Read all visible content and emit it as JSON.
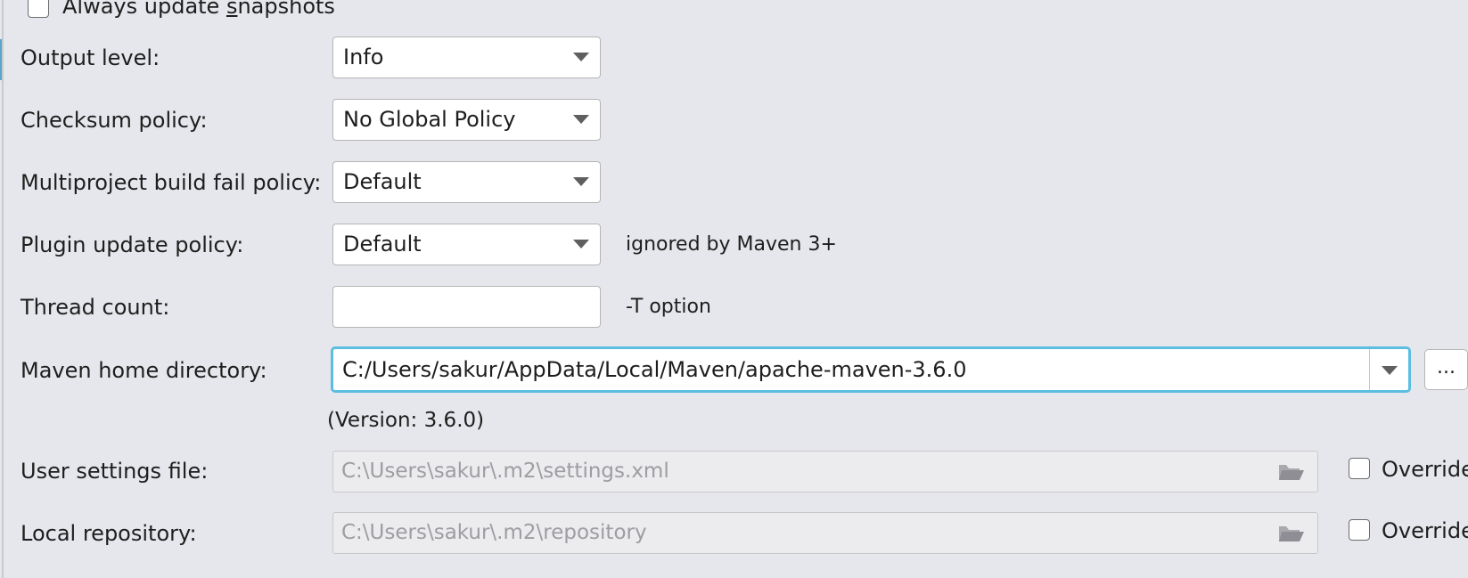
{
  "always_update": {
    "label_prefix": "Always update ",
    "label_mnemonic": "s",
    "label_suffix": "napshots",
    "checked": false
  },
  "output_level": {
    "label": "Output level:",
    "value": "Info"
  },
  "checksum_policy": {
    "label": "Checksum policy:",
    "value": "No Global Policy"
  },
  "multiproject_fail_policy": {
    "label": "Multiproject build fail policy:",
    "value": "Default"
  },
  "plugin_update_policy": {
    "label": "Plugin update policy:",
    "value": "Default",
    "hint": "ignored by Maven 3+"
  },
  "thread_count": {
    "label": "Thread count:",
    "value": "",
    "hint": "-T option"
  },
  "maven_home": {
    "label": "Maven home directory:",
    "value": "C:/Users/sakur/AppData/Local/Maven/apache-maven-3.6.0",
    "browse_label": "...",
    "version_text": "(Version: 3.6.0)"
  },
  "user_settings": {
    "label": "User settings file:",
    "value": "C:\\Users\\sakur\\.m2\\settings.xml",
    "override_label": "Override",
    "override_checked": false
  },
  "local_repository": {
    "label": "Local repository:",
    "value": "C:\\Users\\sakur\\.m2\\repository",
    "override_label": "Override",
    "override_checked": false
  },
  "icons": {
    "dropdown": "chevron-down-icon",
    "folder": "folder-open-icon"
  },
  "colors": {
    "background": "#e6e7ec",
    "focus_border": "#5bbde0",
    "disabled_text": "#9d9da2"
  }
}
